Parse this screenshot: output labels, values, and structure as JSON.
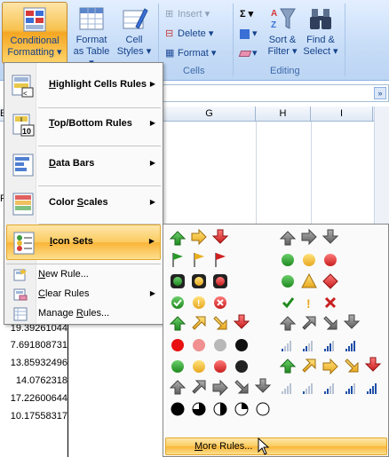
{
  "ribbon": {
    "conditional_formatting": [
      "Conditional",
      "Formatting ▾"
    ],
    "format_as_table": [
      "Format",
      "as Table ▾"
    ],
    "cell_styles": [
      "Cell",
      "Styles ▾"
    ],
    "insert": "Insert ▾",
    "delete": "Delete ▾",
    "format": "Format ▾",
    "cells_group": "Cells",
    "sum": "Σ ▾",
    "fill": "▾",
    "clear": "▾",
    "sort_filter": [
      "Sort &",
      "Filter ▾"
    ],
    "find_select": [
      "Find &",
      "Select ▾"
    ],
    "editing_group": "Editing"
  },
  "sheet": {
    "columns": [
      "G",
      "H",
      "I"
    ],
    "partial_col_e": "E",
    "partial_pr": "Pr",
    "values": [
      "19.39261044",
      "7.691808731",
      "13.85932496",
      "14.0762318",
      "17.22600644",
      "10.17558317"
    ]
  },
  "menu": {
    "items": [
      {
        "label": "Highlight Cells Rules",
        "underline": "H",
        "rest": "ighlight Cells Rules"
      },
      {
        "label": "Top/Bottom Rules",
        "underline": "T",
        "rest": "op/Bottom Rules"
      },
      {
        "label": "Data Bars",
        "underline": "D",
        "rest": "ata Bars"
      },
      {
        "label": "Color Scales",
        "underline": "S",
        "pre": "Color ",
        "rest": "cales"
      },
      {
        "label": "Icon Sets",
        "underline": "I",
        "rest": "con Sets"
      }
    ],
    "small_items": [
      {
        "underline": "N",
        "rest": "ew Rule..."
      },
      {
        "underline": "C",
        "rest": "lear Rules"
      },
      {
        "pre": "Manage ",
        "underline": "R",
        "rest": "ules..."
      }
    ]
  },
  "iconsets": {
    "more_rules": {
      "pre": "",
      "underline": "M",
      "rest": "ore Rules..."
    }
  },
  "colors": {
    "accent": "#fccb5e",
    "ribbon": "#c6dcf7",
    "text": "#15428b"
  }
}
